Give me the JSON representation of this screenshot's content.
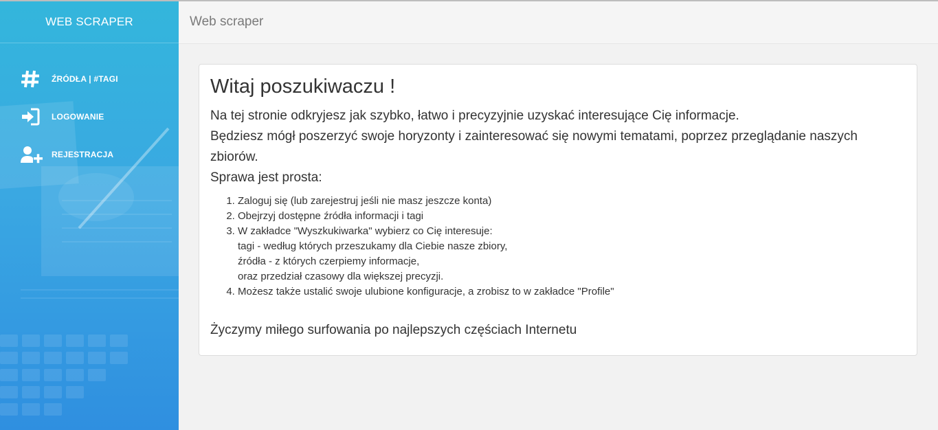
{
  "app": {
    "brand": "WEB SCRAPER",
    "header_title": "Web scraper"
  },
  "sidebar": {
    "items": [
      {
        "icon": "hashtag-icon",
        "label": "ŹRÓDŁA | #TAGI"
      },
      {
        "icon": "sign-in-icon",
        "label": "LOGOWANIE"
      },
      {
        "icon": "user-plus-icon",
        "label": "REJESTRACJA"
      }
    ]
  },
  "content": {
    "title": "Witaj poszukiwaczu !",
    "intro": [
      "Na tej stronie odkryjesz jak szybko, łatwo i precyzyjnie uzyskać interesujące Cię informacje.",
      "Będziesz mógł poszerzyć swoje horyzonty i zainteresować się nowymi tematami, poprzez przeglądanie naszych zbiorów.",
      "Sprawa jest prosta:"
    ],
    "steps": [
      {
        "text": "Zaloguj się (lub zarejestruj jeśli nie masz jeszcze konta)"
      },
      {
        "text": "Obejrzyj dostępne źródła informacji i tagi"
      },
      {
        "text": "W zakładce \"Wyszkukiwarka\" wybierz co Cię interesuje:",
        "sub": [
          "tagi - według których przeszukamy dla Ciebie nasze zbiory,",
          "źródła - z których czerpiemy informacje,",
          "oraz przedział czasowy dla większej precyzji."
        ]
      },
      {
        "text": "Możesz także ustalić swoje ulubione konfiguracje, a zrobisz to w zakładce \"Profile\""
      }
    ],
    "closing": "Życzymy miłego surfowania po najlepszych częściach Internetu"
  },
  "colors": {
    "sidebar_top": "#33b6dc",
    "sidebar_bottom": "#2f8fe0",
    "text": "#333333",
    "header_text": "#7a7a7a"
  }
}
